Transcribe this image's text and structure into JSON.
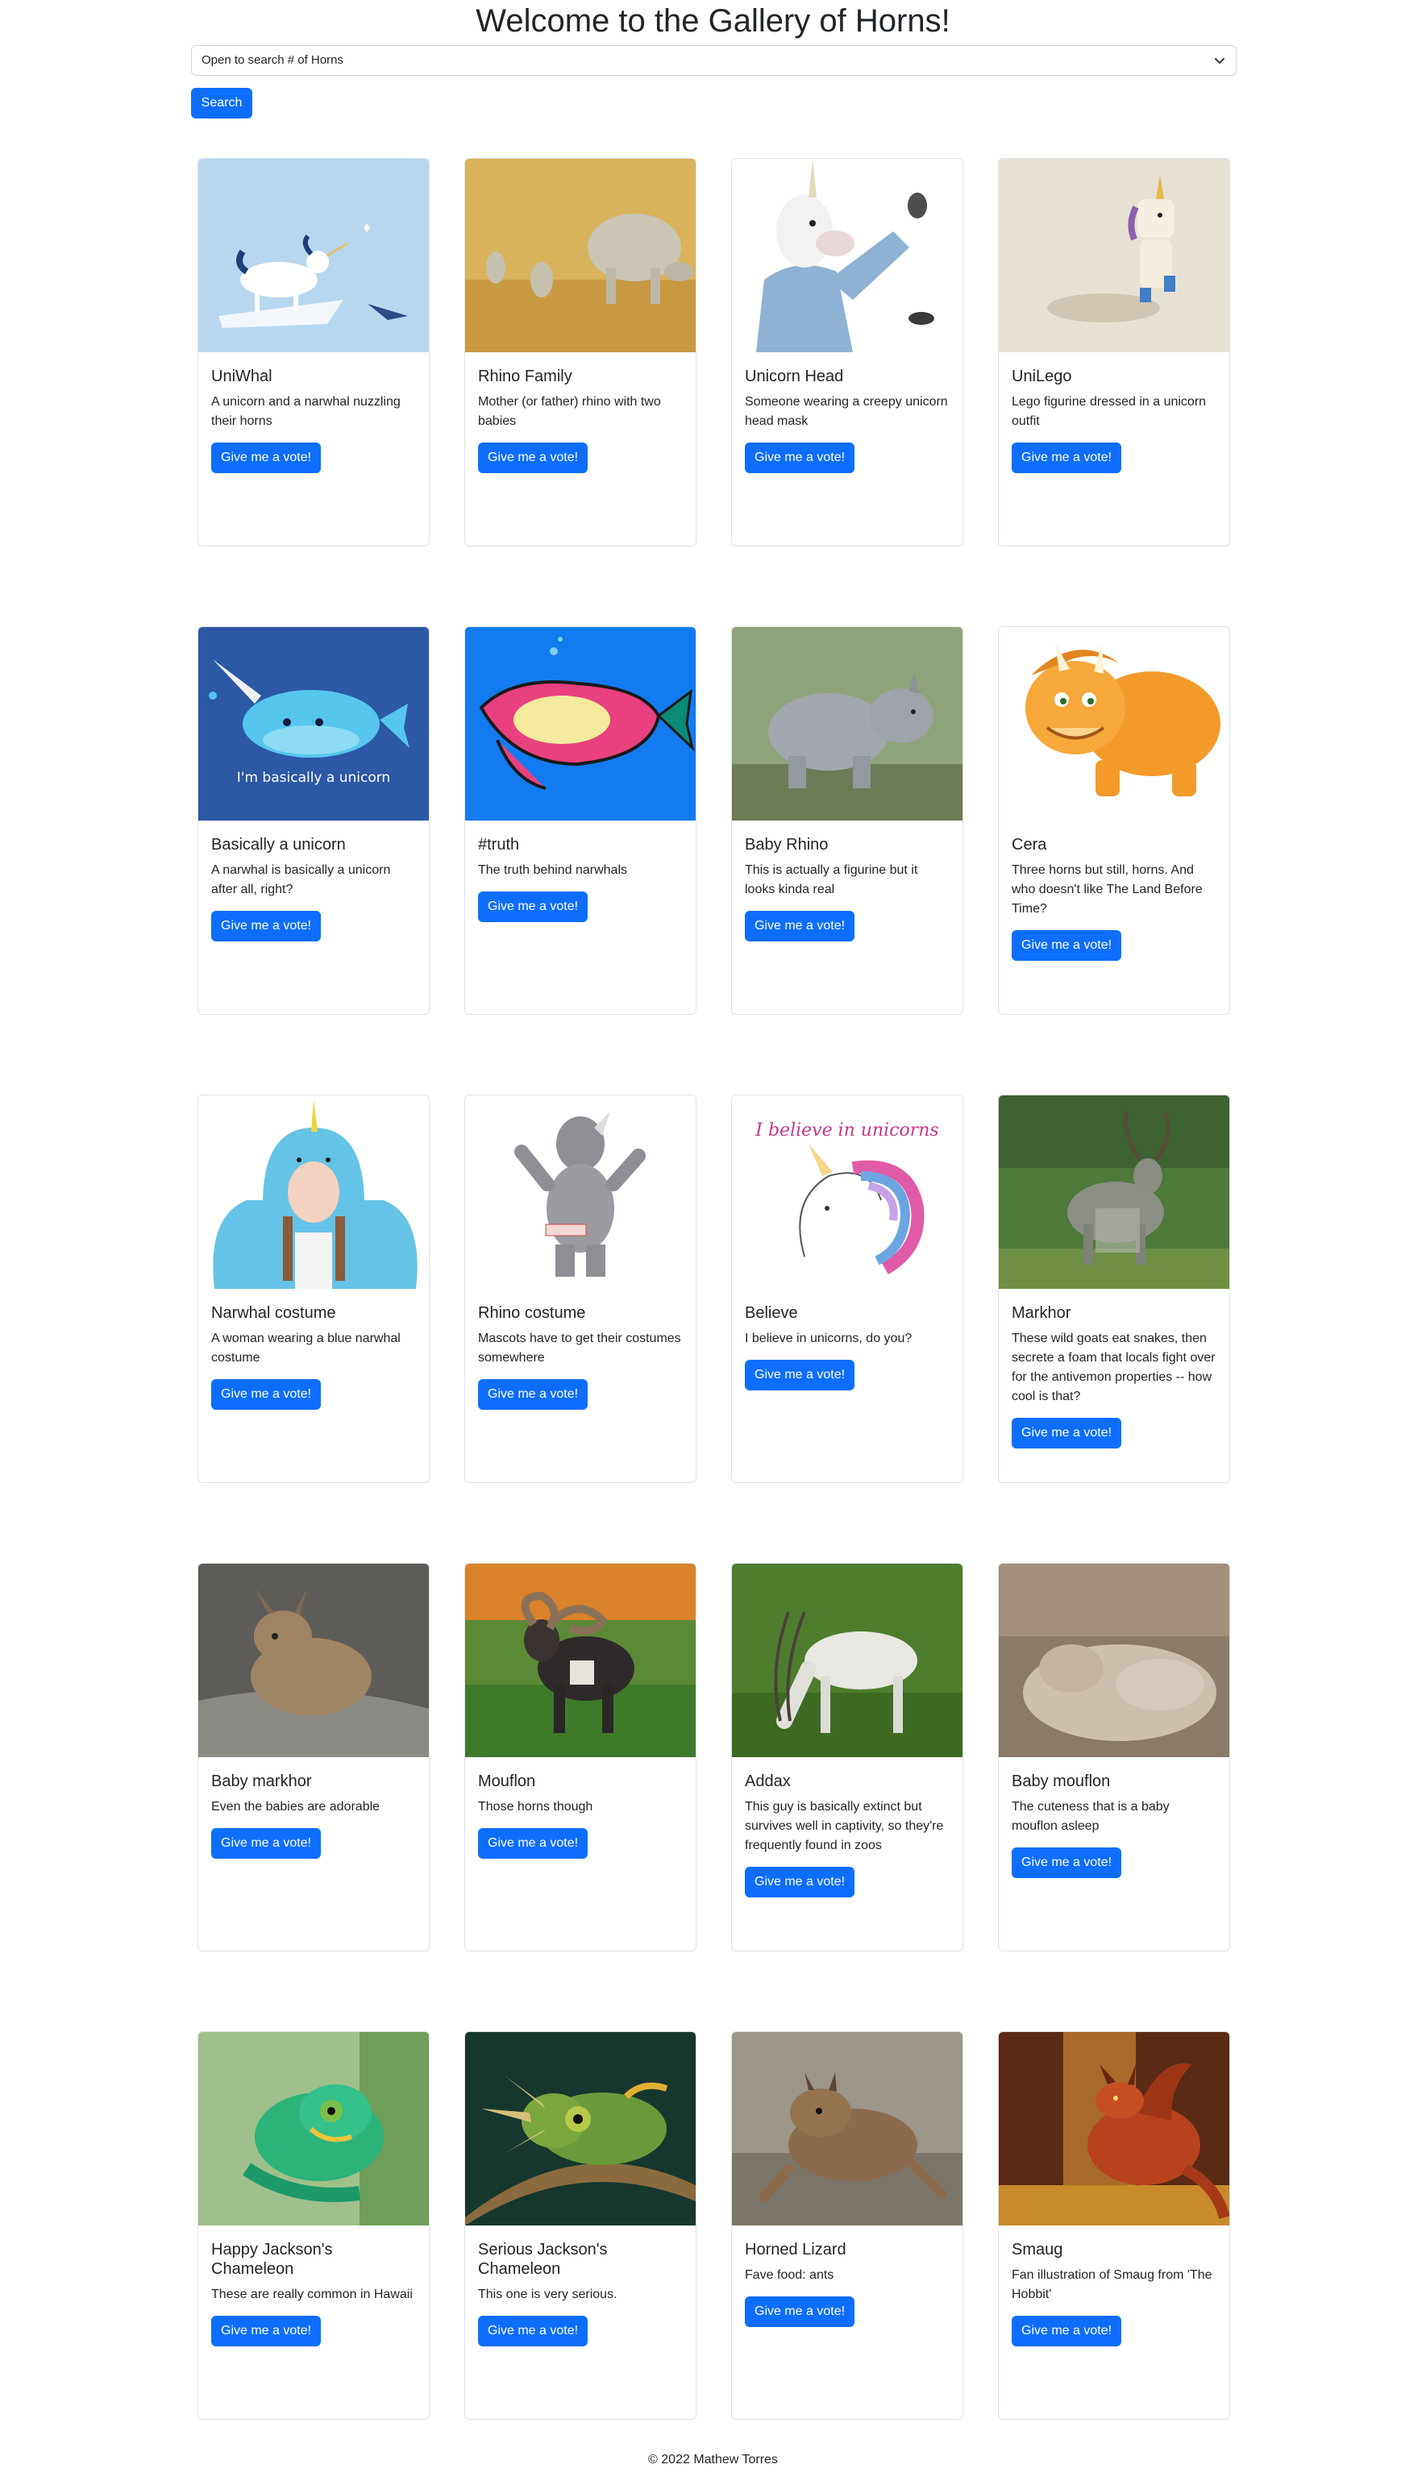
{
  "header": {
    "title": "Welcome to the Gallery of Horns!"
  },
  "search": {
    "select_value": "Open to search # of Horns",
    "button_label": "Search"
  },
  "vote_label": "Give me a vote!",
  "cards": [
    {
      "title": "UniWhal",
      "text": "A unicorn and a narwhal nuzzling their horns",
      "image": "unicorn-narwhal-illustration"
    },
    {
      "title": "Rhino Family",
      "text": "Mother (or father) rhino with two babies",
      "image": "rhino-family-photo"
    },
    {
      "title": "Unicorn Head",
      "text": "Someone wearing a creepy unicorn head mask",
      "image": "unicorn-mask-photo"
    },
    {
      "title": "UniLego",
      "text": "Lego figurine dressed in a unicorn outfit",
      "image": "lego-unicorn-photo"
    },
    {
      "title": "Basically a unicorn",
      "text": "A narwhal is basically a unicorn after all, right?",
      "image": "narwhal-cartoon",
      "image_caption": "I'm basically a unicorn"
    },
    {
      "title": "#truth",
      "text": "The truth behind narwhals",
      "image": "narwhal-truth-illustration"
    },
    {
      "title": "Baby Rhino",
      "text": "This is actually a figurine but it looks kinda real",
      "image": "baby-rhino-photo"
    },
    {
      "title": "Cera",
      "text": "Three horns but still, horns. And who doesn't like The Land Before Time?",
      "image": "cera-triceratops-cartoon"
    },
    {
      "title": "Narwhal costume",
      "text": "A woman wearing a blue narwhal costume",
      "image": "narwhal-costume-photo"
    },
    {
      "title": "Rhino costume",
      "text": "Mascots have to get their costumes somewhere",
      "image": "rhino-mascot-photo"
    },
    {
      "title": "Believe",
      "text": "I believe in unicorns, do you?",
      "image": "believe-unicorn-illustration",
      "image_caption": "I believe in unicorns"
    },
    {
      "title": "Markhor",
      "text": "These wild goats eat snakes, then secrete a foam that locals fight over for the antivemon properties -- how cool is that?",
      "image": "markhor-photo"
    },
    {
      "title": "Baby markhor",
      "text": "Even the babies are adorable",
      "image": "baby-markhor-photo"
    },
    {
      "title": "Mouflon",
      "text": "Those horns though",
      "image": "mouflon-photo"
    },
    {
      "title": "Addax",
      "text": "This guy is basically extinct but survives well in captivity, so they're frequently found in zoos",
      "image": "addax-photo"
    },
    {
      "title": "Baby mouflon",
      "text": "The cuteness that is a baby mouflon asleep",
      "image": "baby-mouflon-photo"
    },
    {
      "title": "Happy Jackson's Chameleon",
      "text": "These are really common in Hawaii",
      "image": "green-chameleon-photo"
    },
    {
      "title": "Serious Jackson's Chameleon",
      "text": "This one is very serious.",
      "image": "serious-chameleon-photo"
    },
    {
      "title": "Horned Lizard",
      "text": "Fave food: ants",
      "image": "horned-lizard-photo"
    },
    {
      "title": "Smaug",
      "text": "Fan illustration of Smaug from 'The Hobbit'",
      "image": "smaug-dragon-illustration"
    }
  ],
  "footer": {
    "text": "© 2022 Mathew Torres"
  },
  "colors": {
    "primary": "#0d6efd",
    "border": "#dfe1e4",
    "text": "#212529"
  }
}
